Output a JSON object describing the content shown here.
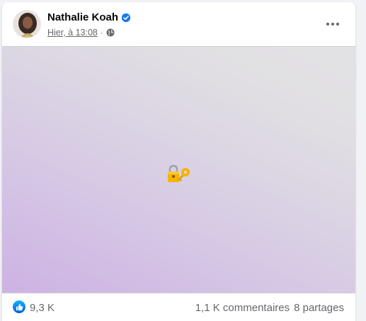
{
  "post": {
    "author": "Nathalie Koah",
    "timestamp": "Hier, à 13:08",
    "separator": "·",
    "audience_icon": "globe-icon",
    "verified_icon": "verified-badge-icon",
    "more_icon": "more-options-icon",
    "media_emoji": "lock-with-key-emoji"
  },
  "reactions": {
    "icon": "like-reaction-icon",
    "count": "9,3 K",
    "comments": "1,1 K commentaires",
    "shares": "8 partages"
  },
  "colors": {
    "verified": "#1877f2",
    "like": "#0062df",
    "text_secondary": "#65676b",
    "media_gradient_start": "#cdb2e3",
    "media_gradient_end": "#e2e2e4"
  }
}
